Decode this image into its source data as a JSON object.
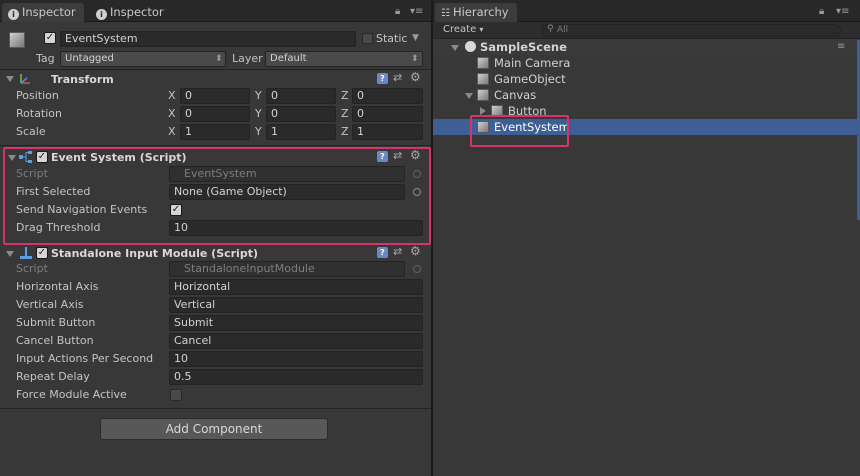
{
  "inspector": {
    "tabs": [
      {
        "label": "Inspector",
        "active": true
      },
      {
        "label": "Inspector",
        "active": false
      }
    ],
    "object": {
      "active": true,
      "name": "EventSystem",
      "static_label": "Static",
      "tag_label": "Tag",
      "tag_value": "Untagged",
      "layer_label": "Layer",
      "layer_value": "Default"
    },
    "transform": {
      "title": "Transform",
      "rows": [
        {
          "label": "Position",
          "x": "0",
          "y": "0",
          "z": "0"
        },
        {
          "label": "Rotation",
          "x": "0",
          "y": "0",
          "z": "0"
        },
        {
          "label": "Scale",
          "x": "1",
          "y": "1",
          "z": "1"
        }
      ],
      "axis_x": "X",
      "axis_y": "Y",
      "axis_z": "Z"
    },
    "event_system": {
      "title": "Event System (Script)",
      "enabled": true,
      "script_label": "Script",
      "script_value": "EventSystem",
      "first_selected_label": "First Selected",
      "first_selected_value": "None (Game Object)",
      "send_nav_label": "Send Navigation Events",
      "send_nav_value": true,
      "drag_threshold_label": "Drag Threshold",
      "drag_threshold_value": "10"
    },
    "input_module": {
      "title": "Standalone Input Module (Script)",
      "enabled": true,
      "script_label": "Script",
      "script_value": "StandaloneInputModule",
      "horizontal_axis_label": "Horizontal Axis",
      "horizontal_axis_value": "Horizontal",
      "vertical_axis_label": "Vertical Axis",
      "vertical_axis_value": "Vertical",
      "submit_label": "Submit Button",
      "submit_value": "Submit",
      "cancel_label": "Cancel Button",
      "cancel_value": "Cancel",
      "ips_label": "Input Actions Per Second",
      "ips_value": "10",
      "repeat_delay_label": "Repeat Delay",
      "repeat_delay_value": "0.5",
      "force_active_label": "Force Module Active",
      "force_active_value": false
    },
    "add_component": "Add Component"
  },
  "hierarchy": {
    "tab_label": "Hierarchy",
    "create_label": "Create",
    "search_placeholder": "All",
    "scene": "SampleScene",
    "items": [
      {
        "label": "Main Camera"
      },
      {
        "label": "GameObject"
      },
      {
        "label": "Canvas"
      },
      {
        "label": "Button"
      },
      {
        "label": "EventSystem",
        "selected": true
      }
    ]
  },
  "colors": {
    "highlight": "#d6336c",
    "selection": "#3e5f96"
  }
}
